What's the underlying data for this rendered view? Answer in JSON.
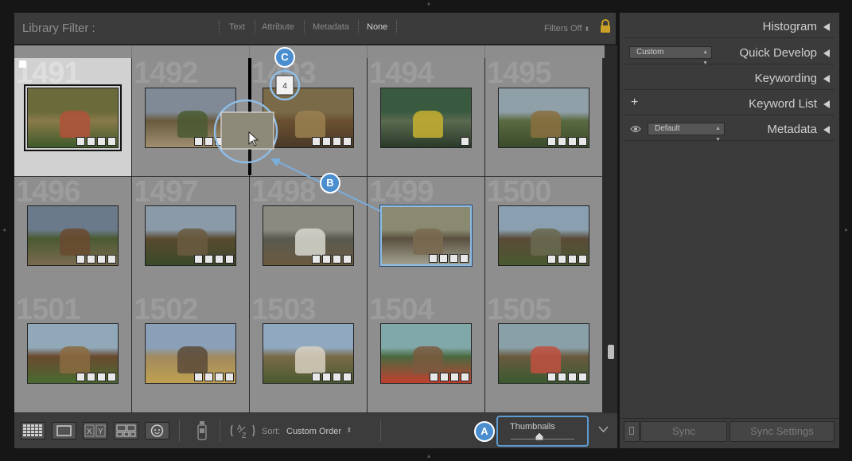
{
  "filter_bar": {
    "title": "Library Filter :",
    "options": [
      "Text",
      "Attribute",
      "Metadata",
      "None"
    ],
    "active_option": "None",
    "filters_label": "Filters Off"
  },
  "grid": {
    "cells": [
      {
        "number": "1491",
        "selected": true,
        "flagged": true
      },
      {
        "number": "1492"
      },
      {
        "number": "1493"
      },
      {
        "number": "1494"
      },
      {
        "number": "1495"
      },
      {
        "number": "1496"
      },
      {
        "number": "1497"
      },
      {
        "number": "1498"
      },
      {
        "number": "1499"
      },
      {
        "number": "1500"
      },
      {
        "number": "1501"
      },
      {
        "number": "1502"
      },
      {
        "number": "1503"
      },
      {
        "number": "1504"
      },
      {
        "number": "1505"
      }
    ],
    "drag_count": "4"
  },
  "toolbar": {
    "sort_label": "Sort:",
    "sort_value": "Custom Order",
    "thumbnails_label": "Thumbnails",
    "thumbnails_level": 0.45
  },
  "right_panel": {
    "panels": [
      "Histogram",
      "Quick Develop",
      "Keywording",
      "Keyword List",
      "Metadata"
    ],
    "quick_develop_preset": "Custom",
    "metadata_preset": "Default",
    "sync_label": "Sync",
    "sync_settings_label": "Sync Settings"
  },
  "callouts": {
    "a": "A",
    "b": "B",
    "c": "C"
  },
  "colors": {
    "accent": "#4a8ed0",
    "panel": "#3b3b3b",
    "cell": "#8e8e8e"
  }
}
